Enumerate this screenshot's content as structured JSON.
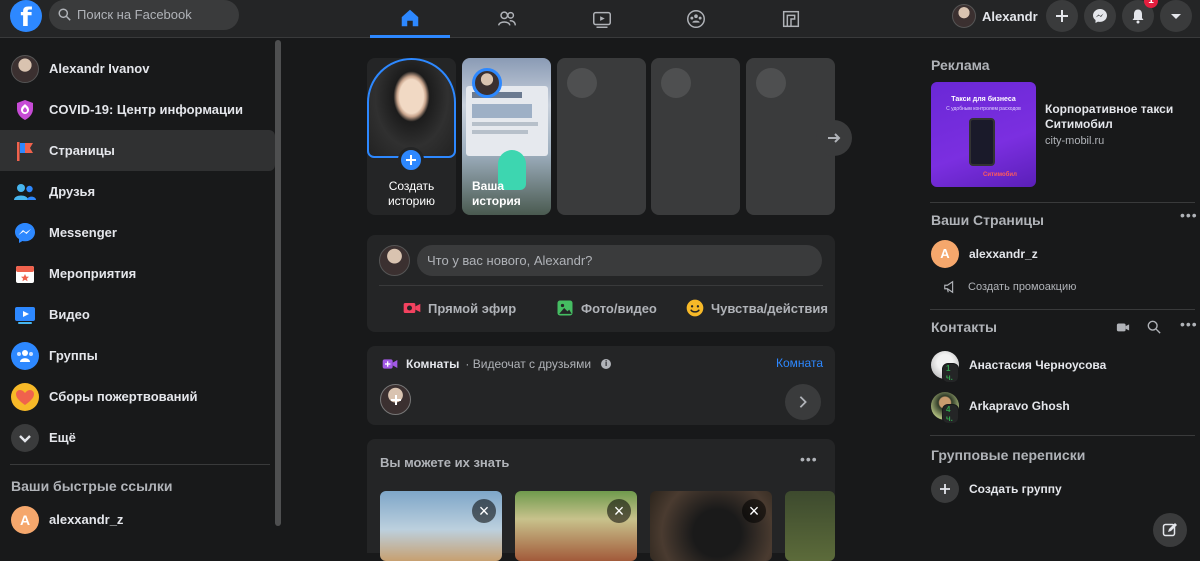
{
  "topbar": {
    "logo": "f",
    "search_placeholder": "Поиск на Facebook",
    "profile_name": "Alexandr",
    "notification_count": "1",
    "tabs": [
      {
        "icon": "home-icon",
        "active": true
      },
      {
        "icon": "friends-icon",
        "active": false
      },
      {
        "icon": "watch-icon",
        "active": false
      },
      {
        "icon": "groups-icon",
        "active": false
      },
      {
        "icon": "gaming-icon",
        "active": false
      }
    ]
  },
  "sidebar": {
    "items": [
      {
        "label": "Alexandr Ivanov",
        "icon": "avatar"
      },
      {
        "label": "COVID-19: Центр информации",
        "icon": "covid-shield-icon"
      },
      {
        "label": "Страницы",
        "icon": "flag-icon"
      },
      {
        "label": "Друзья",
        "icon": "friends-icon"
      },
      {
        "label": "Messenger",
        "icon": "messenger-icon"
      },
      {
        "label": "Мероприятия",
        "icon": "calendar-icon"
      },
      {
        "label": "Видео",
        "icon": "video-icon"
      },
      {
        "label": "Группы",
        "icon": "groups-icon"
      },
      {
        "label": "Сборы пожертвований",
        "icon": "heart-icon"
      },
      {
        "label": "Ещё",
        "icon": "chevron-down-icon"
      }
    ],
    "shortcuts_heading": "Ваши быстрые ссылки",
    "shortcut": {
      "label": "alexxandr_z",
      "initial": "A"
    }
  },
  "stories": {
    "create_label_1": "Создать",
    "create_label_2": "историю",
    "your_label_1": "Ваша",
    "your_label_2": "история"
  },
  "composer": {
    "placeholder": "Что у вас нового, Alexandr?",
    "live": "Прямой эфир",
    "photo": "Фото/видео",
    "feeling": "Чувства/действия"
  },
  "rooms": {
    "title": "Комнаты",
    "subtitle": "· Видеочат с друзьями",
    "link": "Комната"
  },
  "pymk": {
    "title": "Вы можете их знать"
  },
  "right": {
    "ads_heading": "Реклама",
    "ad_title": "Корпоративное такси Ситимобил",
    "ad_domain": "city-mobil.ru",
    "ad_image_text_1": "Такси для бизнеса",
    "ad_image_text_2": "С удобным контролем расходов",
    "ad_image_brand": "Ситимобил",
    "pages_heading": "Ваши Страницы",
    "page_name": "alexxandr_z",
    "page_initial": "A",
    "promo": "Создать промоакцию",
    "contacts_heading": "Контакты",
    "contacts": [
      {
        "name": "Анастасия Черноусова",
        "time": "1 ч."
      },
      {
        "name": "Arkapravo Ghosh",
        "time": "4 ч."
      }
    ],
    "groups_heading": "Групповые переписки",
    "create_group": "Создать группу"
  },
  "colors": {
    "accent": "#2d88ff",
    "background": "#18191a",
    "surface": "#242526",
    "input": "#3a3b3c",
    "badge": "#e41e3f"
  }
}
